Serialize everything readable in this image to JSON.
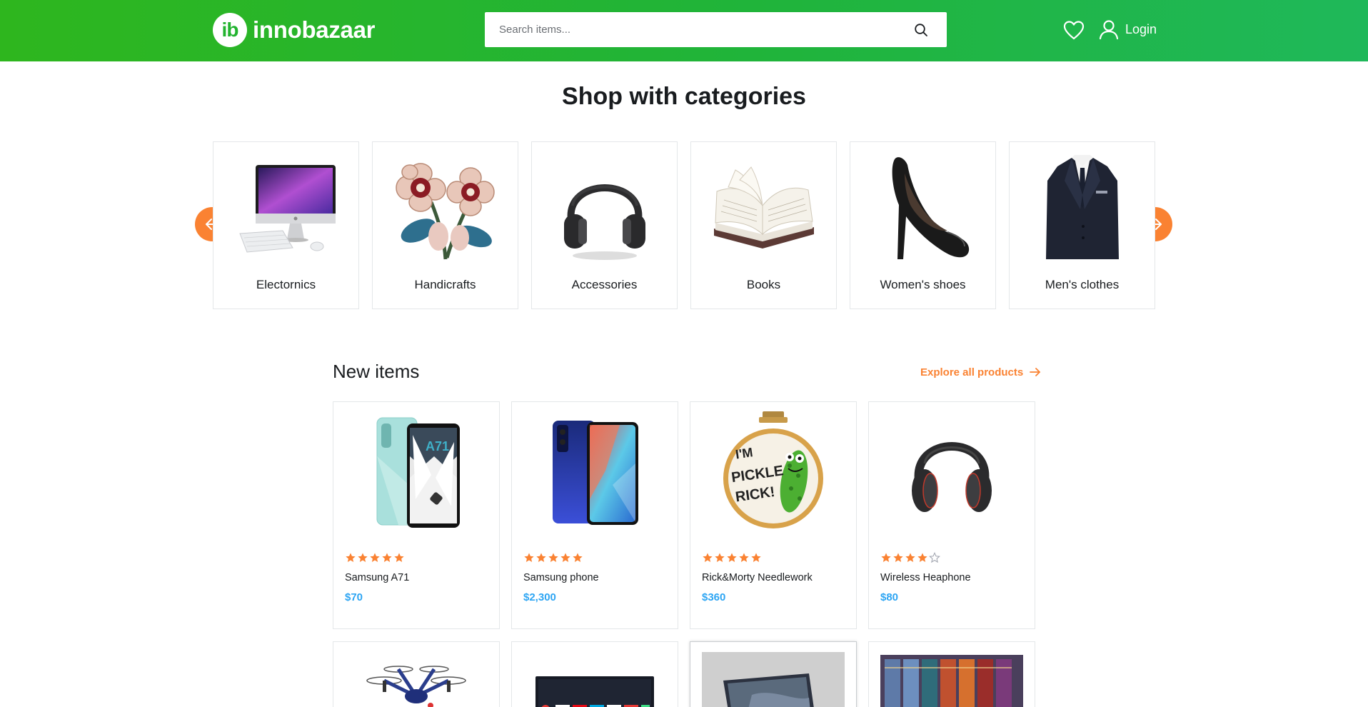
{
  "header": {
    "logo_mark": "ib",
    "logo_text": "innobazaar",
    "search_placeholder": "Search items...",
    "login_label": "Login",
    "accent_color": "#22b32f"
  },
  "categories": {
    "title": "Shop with categories",
    "items": [
      {
        "label": "Electornics",
        "icon": "imac-computer"
      },
      {
        "label": "Handicrafts",
        "icon": "embroidered-flowers"
      },
      {
        "label": "Accessories",
        "icon": "headphones"
      },
      {
        "label": "Books",
        "icon": "open-book"
      },
      {
        "label": "Women's shoes",
        "icon": "high-heel-shoe"
      },
      {
        "label": "Men's clothes",
        "icon": "suit"
      }
    ],
    "prev_icon": "arrow-left-icon",
    "next_icon": "arrow-right-icon",
    "arrow_color": "#fa8232"
  },
  "new_items": {
    "title": "New items",
    "explore_label": "Explore all products",
    "products": [
      {
        "name": "Samsung A71",
        "price": "$70",
        "rating": 5,
        "icon": "phone-a71"
      },
      {
        "name": "Samsung phone",
        "price": "$2,300",
        "rating": 5,
        "icon": "phone-blue"
      },
      {
        "name": "Rick&Morty Needlework",
        "price": "$360",
        "rating": 5,
        "icon": "embroidery-hoop"
      },
      {
        "name": "Wireless Heaphone",
        "price": "$80",
        "rating": 4,
        "icon": "headphones"
      }
    ],
    "row2_icons": [
      "drone",
      "tv",
      "laptop",
      "book-box-set"
    ],
    "price_color": "#2da5f3",
    "star_color": "#fa8232"
  }
}
